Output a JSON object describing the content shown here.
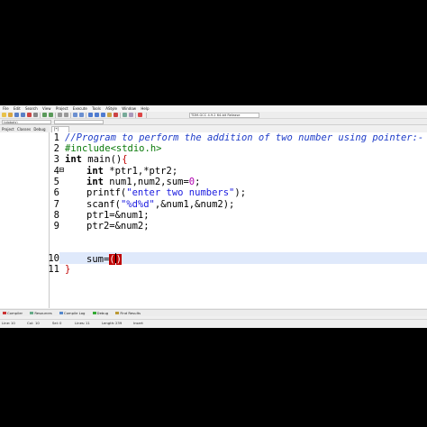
{
  "menu": [
    "File",
    "Edit",
    "Search",
    "View",
    "Project",
    "Execute",
    "Tools",
    "AStyle",
    "Window",
    "Help"
  ],
  "toolbar": {
    "scope_combo": "(globals)",
    "compiler_combo": "TDM-GCC 4.9.2 64-bit Release",
    "compile_label": "Compile"
  },
  "panel_tabs": [
    "Project",
    "Classes",
    "Debug"
  ],
  "editor_tab": "[*] Untitled1",
  "code_lines": [
    {
      "n": "1",
      "text": "//Program to perform the addition of two number using pointer:-"
    },
    {
      "n": "2",
      "text": "#include<stdio.h>"
    },
    {
      "n": "3",
      "text": "int main(){"
    },
    {
      "n": "4",
      "text": "int *ptr1,*ptr2;"
    },
    {
      "n": "5",
      "text": "int num1,num2,sum=0;"
    },
    {
      "n": "6",
      "text": "printf(\"enter two numbers\");"
    },
    {
      "n": "7",
      "text": "scanf(\"%d%d\",&num1,&num2);"
    },
    {
      "n": "8",
      "text": "ptr1=&num1;"
    },
    {
      "n": "9",
      "text": "ptr2=&num2;"
    },
    {
      "n": "10",
      "text": "sum=()"
    },
    {
      "n": "11",
      "text": "}"
    }
  ],
  "bottom_tabs": [
    "Compiler",
    "Resources",
    "Compile Log",
    "Debug",
    "Find Results"
  ],
  "status": {
    "line_label": "Line:",
    "line_value": "10",
    "col_label": "Col:",
    "col_value": "10",
    "sel_label": "Sel:",
    "sel_value": "0",
    "lines_label": "Lines:",
    "lines_value": "11",
    "length_label": "Length:",
    "length_value": "239",
    "mode": "Insert"
  },
  "colors": {
    "comment": "#1e3cc8",
    "string": "#1a1ae0",
    "number": "#b000b0",
    "brace": "#c00000",
    "current_line": "#dfe9fb"
  }
}
